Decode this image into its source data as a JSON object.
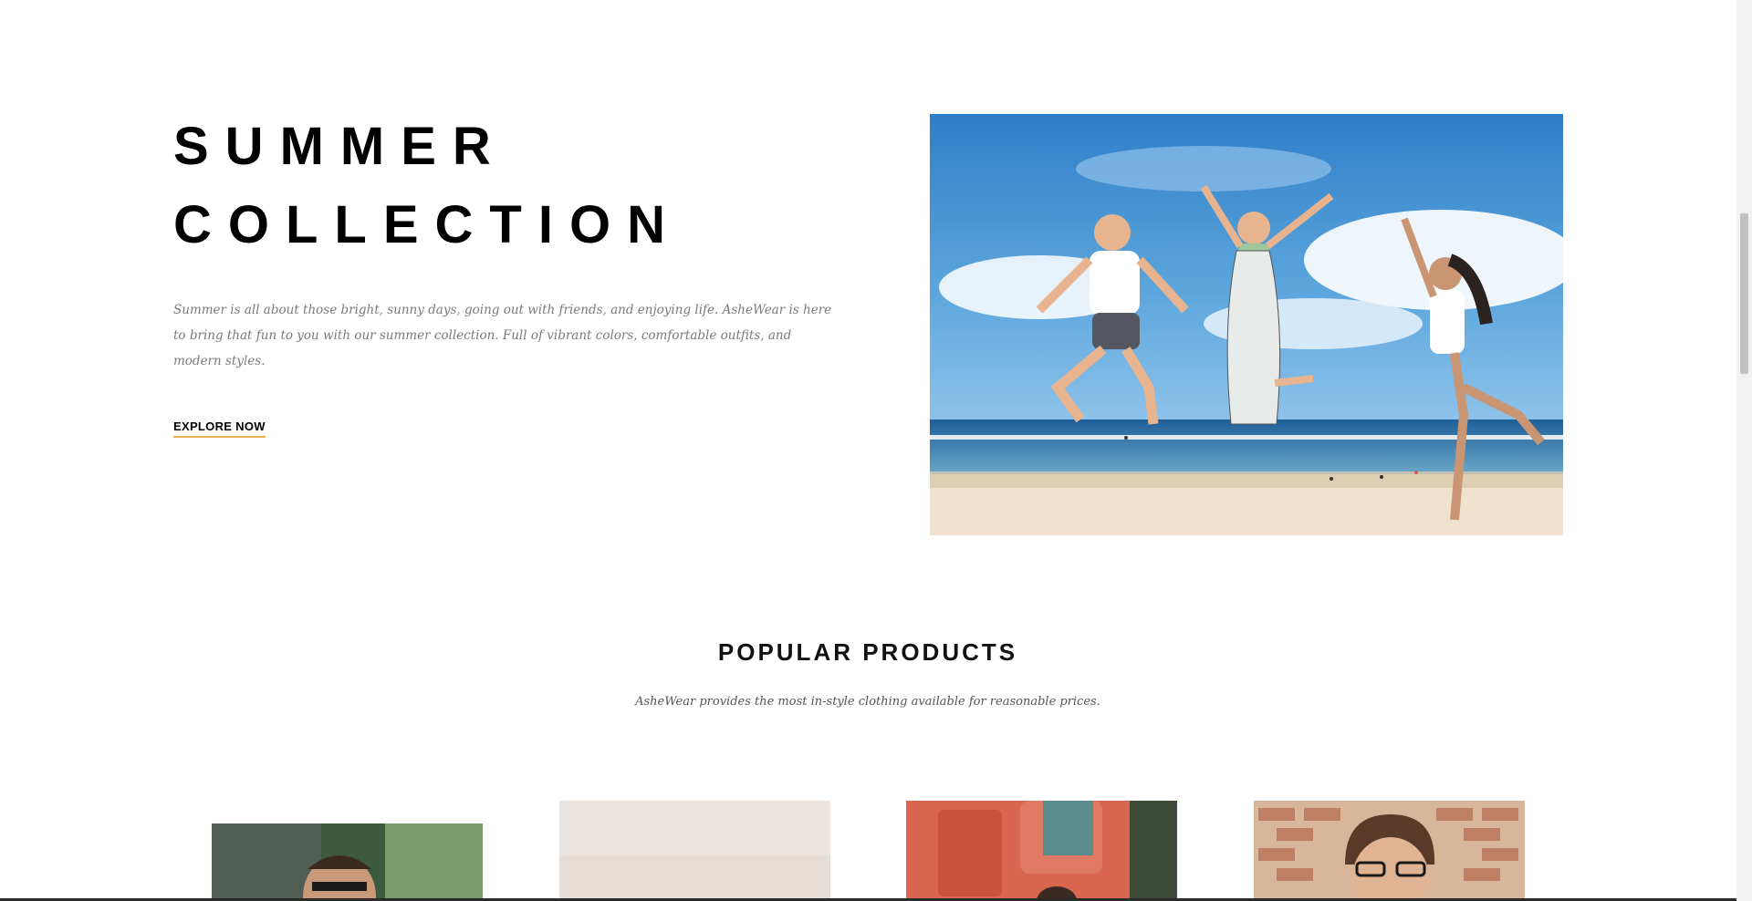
{
  "hero": {
    "title_line1": "SUMMER",
    "title_line2": "COLLECTION",
    "description": "Summer is all about those bright, sunny days, going out with friends, and enjoying life. AsheWear is here to bring that fun to you with our summer collection. Full of vibrant colors, comfortable outfits, and modern styles.",
    "cta_label": "EXPLORE NOW",
    "cta_underline_color": "#e8b04a"
  },
  "popular": {
    "title": "POPULAR PRODUCTS",
    "subtitle": "AsheWear provides the most in-style clothing available for reasonable prices."
  },
  "colors": {
    "text": "#000000",
    "muted": "#7a7a7a",
    "accent": "#e8b04a",
    "background": "#ffffff"
  }
}
